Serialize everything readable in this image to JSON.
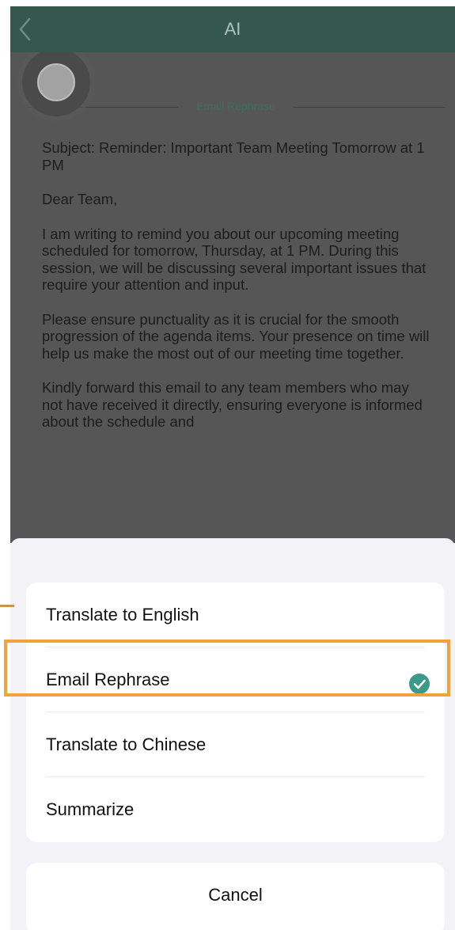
{
  "navbar": {
    "title": "AI",
    "bg_color": "#35574d",
    "back_icon": "chevron-left-icon"
  },
  "content": {
    "section_label": "Email Rephrase",
    "floating_button_icon": "record-circle-icon",
    "email": [
      "Subject: Reminder: Important Team Meeting Tomorrow at 1 PM",
      "Dear Team,",
      "I am writing to remind you about our upcoming meeting scheduled for tomorrow, Thursday, at 1 PM. During this session, we will be discussing several important issues that require your attention and input.",
      "Please ensure punctuality as it is crucial for the smooth progression of the agenda items. Your presence on time will help us make the most out of our meeting time together.",
      "Kindly forward this email to any team members who may not have received it directly, ensuring everyone is informed about the schedule and"
    ]
  },
  "sheet": {
    "options": [
      {
        "label": "Translate to English",
        "selected": false
      },
      {
        "label": "Email Rephrase",
        "selected": true
      },
      {
        "label": "Translate to Chinese",
        "selected": false
      },
      {
        "label": "Summarize",
        "selected": false
      }
    ],
    "selected_icon": "checkmark-circle-icon",
    "selected_color": "#3d9a8a",
    "cancel_label": "Cancel"
  },
  "highlight_color": "#f2a23a"
}
